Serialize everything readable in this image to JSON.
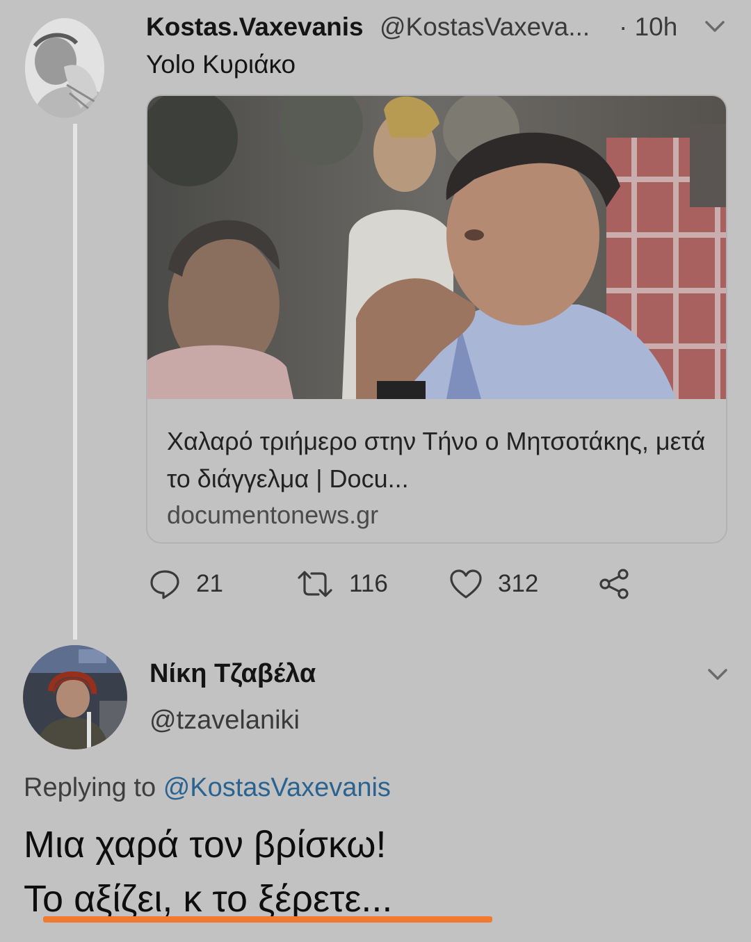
{
  "tweet": {
    "author_name": "Kostas.Vaxevanis",
    "author_handle": "@KostasVaxeva...",
    "time": "· 10h",
    "text": "Yolo Κυριάκο",
    "card": {
      "title": "Χαλαρό τριήμερο στην Τήνο ο Μητσοτάκης, μετά το διάγγελμα | Docu...",
      "domain": "documentonews.gr"
    },
    "actions": {
      "reply_count": "21",
      "retweet_count": "116",
      "like_count": "312"
    }
  },
  "reply": {
    "author_name": "Νίκη Τζαβέλα",
    "author_handle": "@tzavelaniki",
    "replying_prefix": "Replying to",
    "replying_to": "@KostasVaxevanis",
    "text_line1": "Μια χαρά τον βρίσκω!",
    "text_line2": "Το αξίζει, κ το ξέρετε...",
    "underline_color": "#f27a30"
  },
  "icons": [
    "avatar",
    "chevron-down-icon",
    "reply-icon",
    "retweet-icon",
    "like-icon",
    "share-icon"
  ]
}
